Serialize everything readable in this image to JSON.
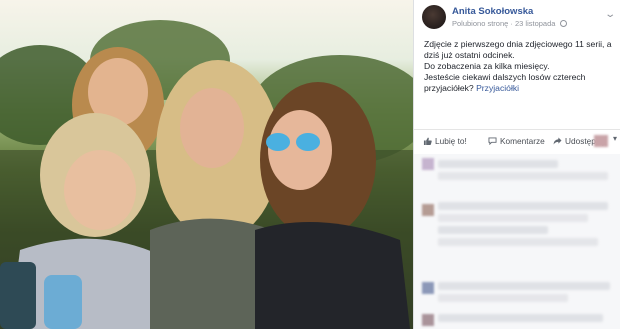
{
  "post": {
    "author": "Anita Sokołowska",
    "liked_label": "Polubiono stronę",
    "date": "23 listopada",
    "paragraphs": [
      "Zdjęcie z pierwszego dnia zdjęciowego 11 serii, a dziś już ostatni odcinek.",
      "Do zobaczenia za kilka miesięcy.",
      "Jesteście ciekawi dalszych losów czterech przyjaciółek?"
    ],
    "hashtag": "Przyjaciółki"
  },
  "actions": {
    "like": "Lubię to!",
    "comment": "Komentarze",
    "share": "Udostępnij"
  },
  "icons": [
    "avatar",
    "globe-icon",
    "chevron-down-icon",
    "like-icon",
    "comment-icon",
    "share-icon"
  ],
  "colors": {
    "link": "#365899",
    "meta": "#90949c",
    "text": "#1d2129"
  }
}
